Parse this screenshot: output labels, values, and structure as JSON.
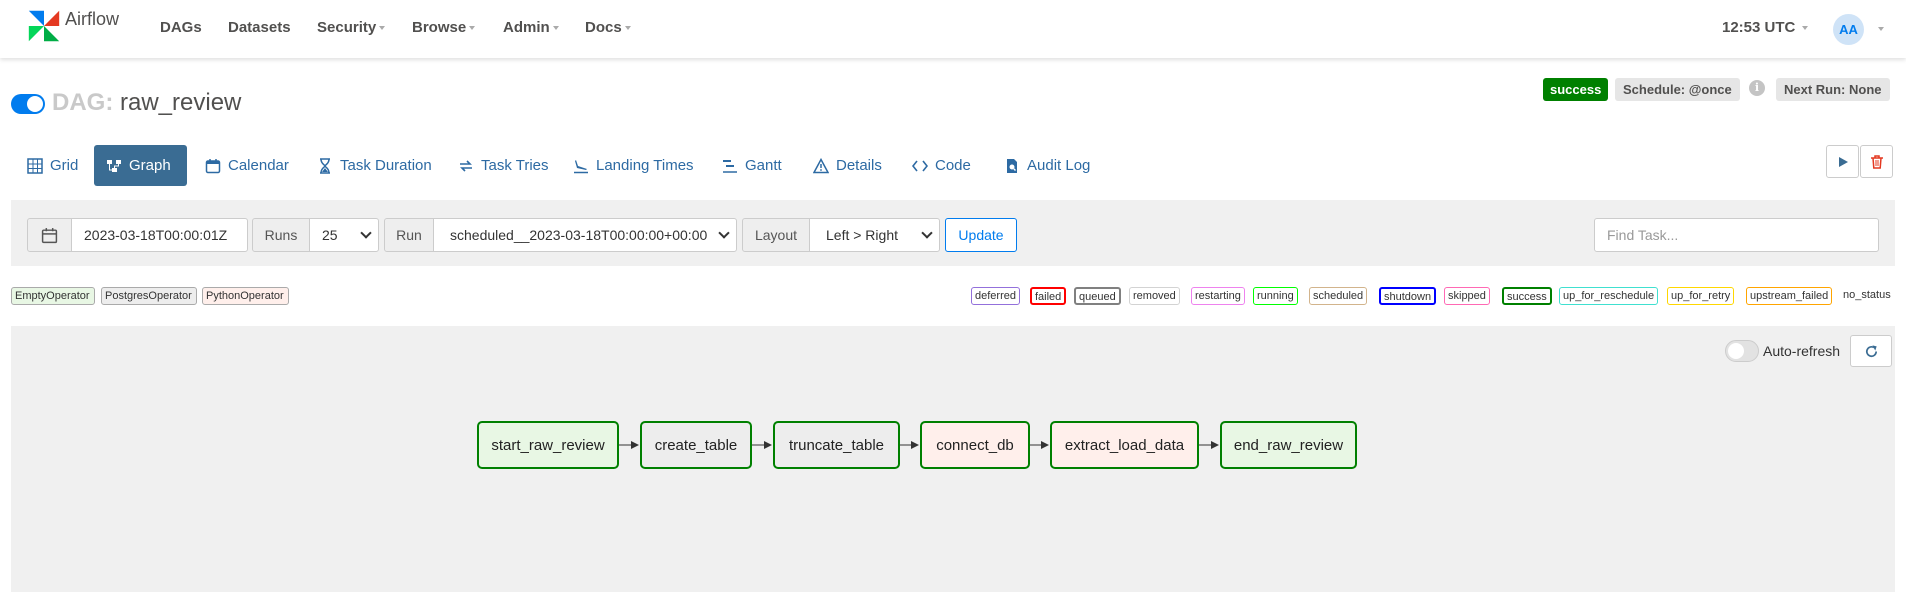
{
  "navbar": {
    "brand": "Airflow",
    "items": [
      {
        "label": "DAGs",
        "dropdown": false
      },
      {
        "label": "Datasets",
        "dropdown": false
      },
      {
        "label": "Security",
        "dropdown": true
      },
      {
        "label": "Browse",
        "dropdown": true
      },
      {
        "label": "Admin",
        "dropdown": true
      },
      {
        "label": "Docs",
        "dropdown": true
      }
    ],
    "clock": "12:53 UTC",
    "user_initials": "AA"
  },
  "dag": {
    "label": "DAG:",
    "name": "raw_review",
    "status": "success",
    "schedule": "Schedule: @once",
    "info_glyph": "i",
    "next_run": "Next Run: None"
  },
  "tabs": [
    {
      "label": "Grid",
      "icon": "grid-icon"
    },
    {
      "label": "Graph",
      "icon": "graph-icon",
      "active": true
    },
    {
      "label": "Calendar",
      "icon": "calendar-icon"
    },
    {
      "label": "Task Duration",
      "icon": "hourglass-icon"
    },
    {
      "label": "Task Tries",
      "icon": "retry-icon"
    },
    {
      "label": "Landing Times",
      "icon": "plane-landing-icon"
    },
    {
      "label": "Gantt",
      "icon": "gantt-icon"
    },
    {
      "label": "Details",
      "icon": "warning-triangle-icon"
    },
    {
      "label": "Code",
      "icon": "code-icon"
    },
    {
      "label": "Audit Log",
      "icon": "audit-log-icon"
    }
  ],
  "controls": {
    "base_date": "2023-03-18T00:00:01Z",
    "runs_label": "Runs",
    "runs_value": "25",
    "run_label": "Run",
    "run_value": "scheduled__2023-03-18T00:00:00+00:00",
    "layout_label": "Layout",
    "layout_value": "Left > Right",
    "update_label": "Update",
    "find_placeholder": "Find Task..."
  },
  "operator_legend": [
    {
      "label": "EmptyOperator",
      "bg": "#e8f7e4"
    },
    {
      "label": "PostgresOperator",
      "bg": "#ededed"
    },
    {
      "label": "PythonOperator",
      "bg": "#ffefeb"
    }
  ],
  "state_legend": [
    {
      "label": "deferred",
      "color": "#9370db"
    },
    {
      "label": "failed",
      "color": "#ff0000"
    },
    {
      "label": "queued",
      "color": "#808080"
    },
    {
      "label": "removed",
      "color": "#d3d3d3"
    },
    {
      "label": "restarting",
      "color": "#ee82ee"
    },
    {
      "label": "running",
      "color": "#00ff00"
    },
    {
      "label": "scheduled",
      "color": "#d2b48c"
    },
    {
      "label": "shutdown",
      "color": "#0000ff"
    },
    {
      "label": "skipped",
      "color": "#ff69b4"
    },
    {
      "label": "success",
      "color": "#008000"
    },
    {
      "label": "up_for_reschedule",
      "color": "#40e0d0"
    },
    {
      "label": "up_for_retry",
      "color": "#ffd700"
    },
    {
      "label": "upstream_failed",
      "color": "#ffa500"
    },
    {
      "label": "no_status",
      "color": ""
    }
  ],
  "graph": {
    "auto_refresh_label": "Auto-refresh",
    "tasks": [
      {
        "id": "start_raw_review",
        "operator": "empty"
      },
      {
        "id": "create_table",
        "operator": "pg"
      },
      {
        "id": "truncate_table",
        "operator": "pg"
      },
      {
        "id": "connect_db",
        "operator": "py"
      },
      {
        "id": "extract_load_data",
        "operator": "py"
      },
      {
        "id": "end_raw_review",
        "operator": "empty"
      }
    ]
  }
}
